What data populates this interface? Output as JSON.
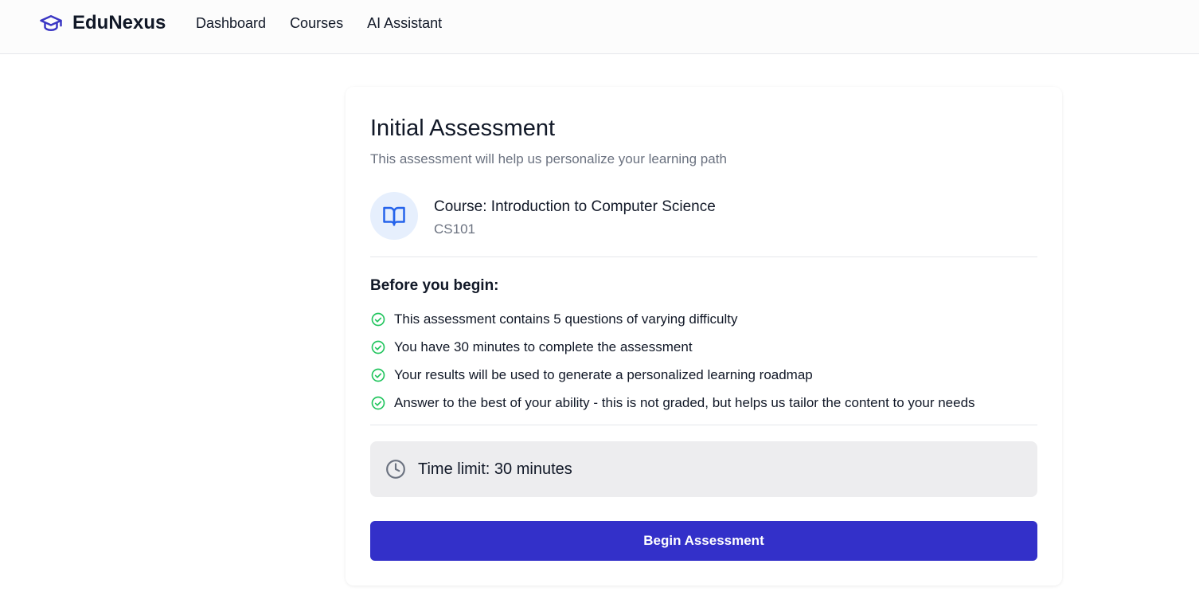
{
  "brand": {
    "name": "EduNexus",
    "icon": "graduation-cap-icon",
    "accent": "#3b37c4"
  },
  "nav": {
    "items": [
      "Dashboard",
      "Courses",
      "AI Assistant"
    ]
  },
  "assessment": {
    "title": "Initial Assessment",
    "subtitle": "This assessment will help us personalize your learning path",
    "course": {
      "icon": "open-book-icon",
      "name": "Course: Introduction to Computer Science",
      "code": "CS101"
    },
    "before_title": "Before you begin:",
    "check_color": "#22c55e",
    "items": [
      "This assessment contains 5 questions of varying difficulty",
      "You have 30 minutes to complete the assessment",
      "Your results will be used to generate a personalized learning roadmap",
      "Answer to the best of your ability - this is not graded, but helps us tailor the content to your needs"
    ],
    "time_limit": {
      "icon": "clock-icon",
      "label": "Time limit: 30 minutes"
    },
    "begin_label": "Begin Assessment",
    "button_color": "#3330c9"
  }
}
